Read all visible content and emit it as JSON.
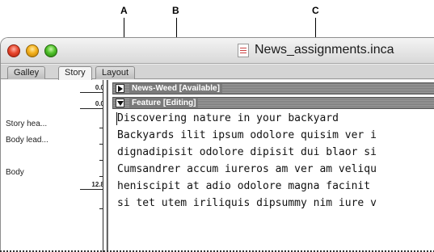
{
  "callouts": [
    "A",
    "B",
    "C"
  ],
  "window": {
    "title": "News_assignments.inca",
    "file_icon": "document-icon"
  },
  "tabs": [
    {
      "label": "Galley",
      "active": false
    },
    {
      "label": "Story",
      "active": true
    },
    {
      "label": "Layout",
      "active": false
    }
  ],
  "info_column": [
    {
      "label": "",
      "value": "0.0"
    },
    {
      "label": "",
      "value": "0.0"
    },
    {
      "label": "Story hea...",
      "value": ""
    },
    {
      "label": "Body lead...",
      "value": ""
    },
    {
      "label": "",
      "value": ""
    },
    {
      "label": "Body",
      "value": ""
    },
    {
      "label": "",
      "value": "12.8"
    },
    {
      "label": "",
      "value": ""
    }
  ],
  "stories": [
    {
      "title": "News-Weed [Available]",
      "expanded": false
    },
    {
      "title": "Feature [Editing]",
      "expanded": true
    }
  ],
  "story_text": [
    "Discovering nature in your backyard",
    "Backyards ilit ipsum odolore quisim ver i",
    "dignadipisit odolore dipisit dui blaor si",
    "Cumsandrer accum iureros am ver am veliqu",
    "heniscipit at adio odolore magna facinit",
    "si tet utem iriliquis dipsummy nim iure v"
  ],
  "colors": {
    "close": "#e8482f",
    "minimize": "#f3b01c",
    "zoom": "#4fc12a",
    "header_bar": "#7a7a7a"
  }
}
